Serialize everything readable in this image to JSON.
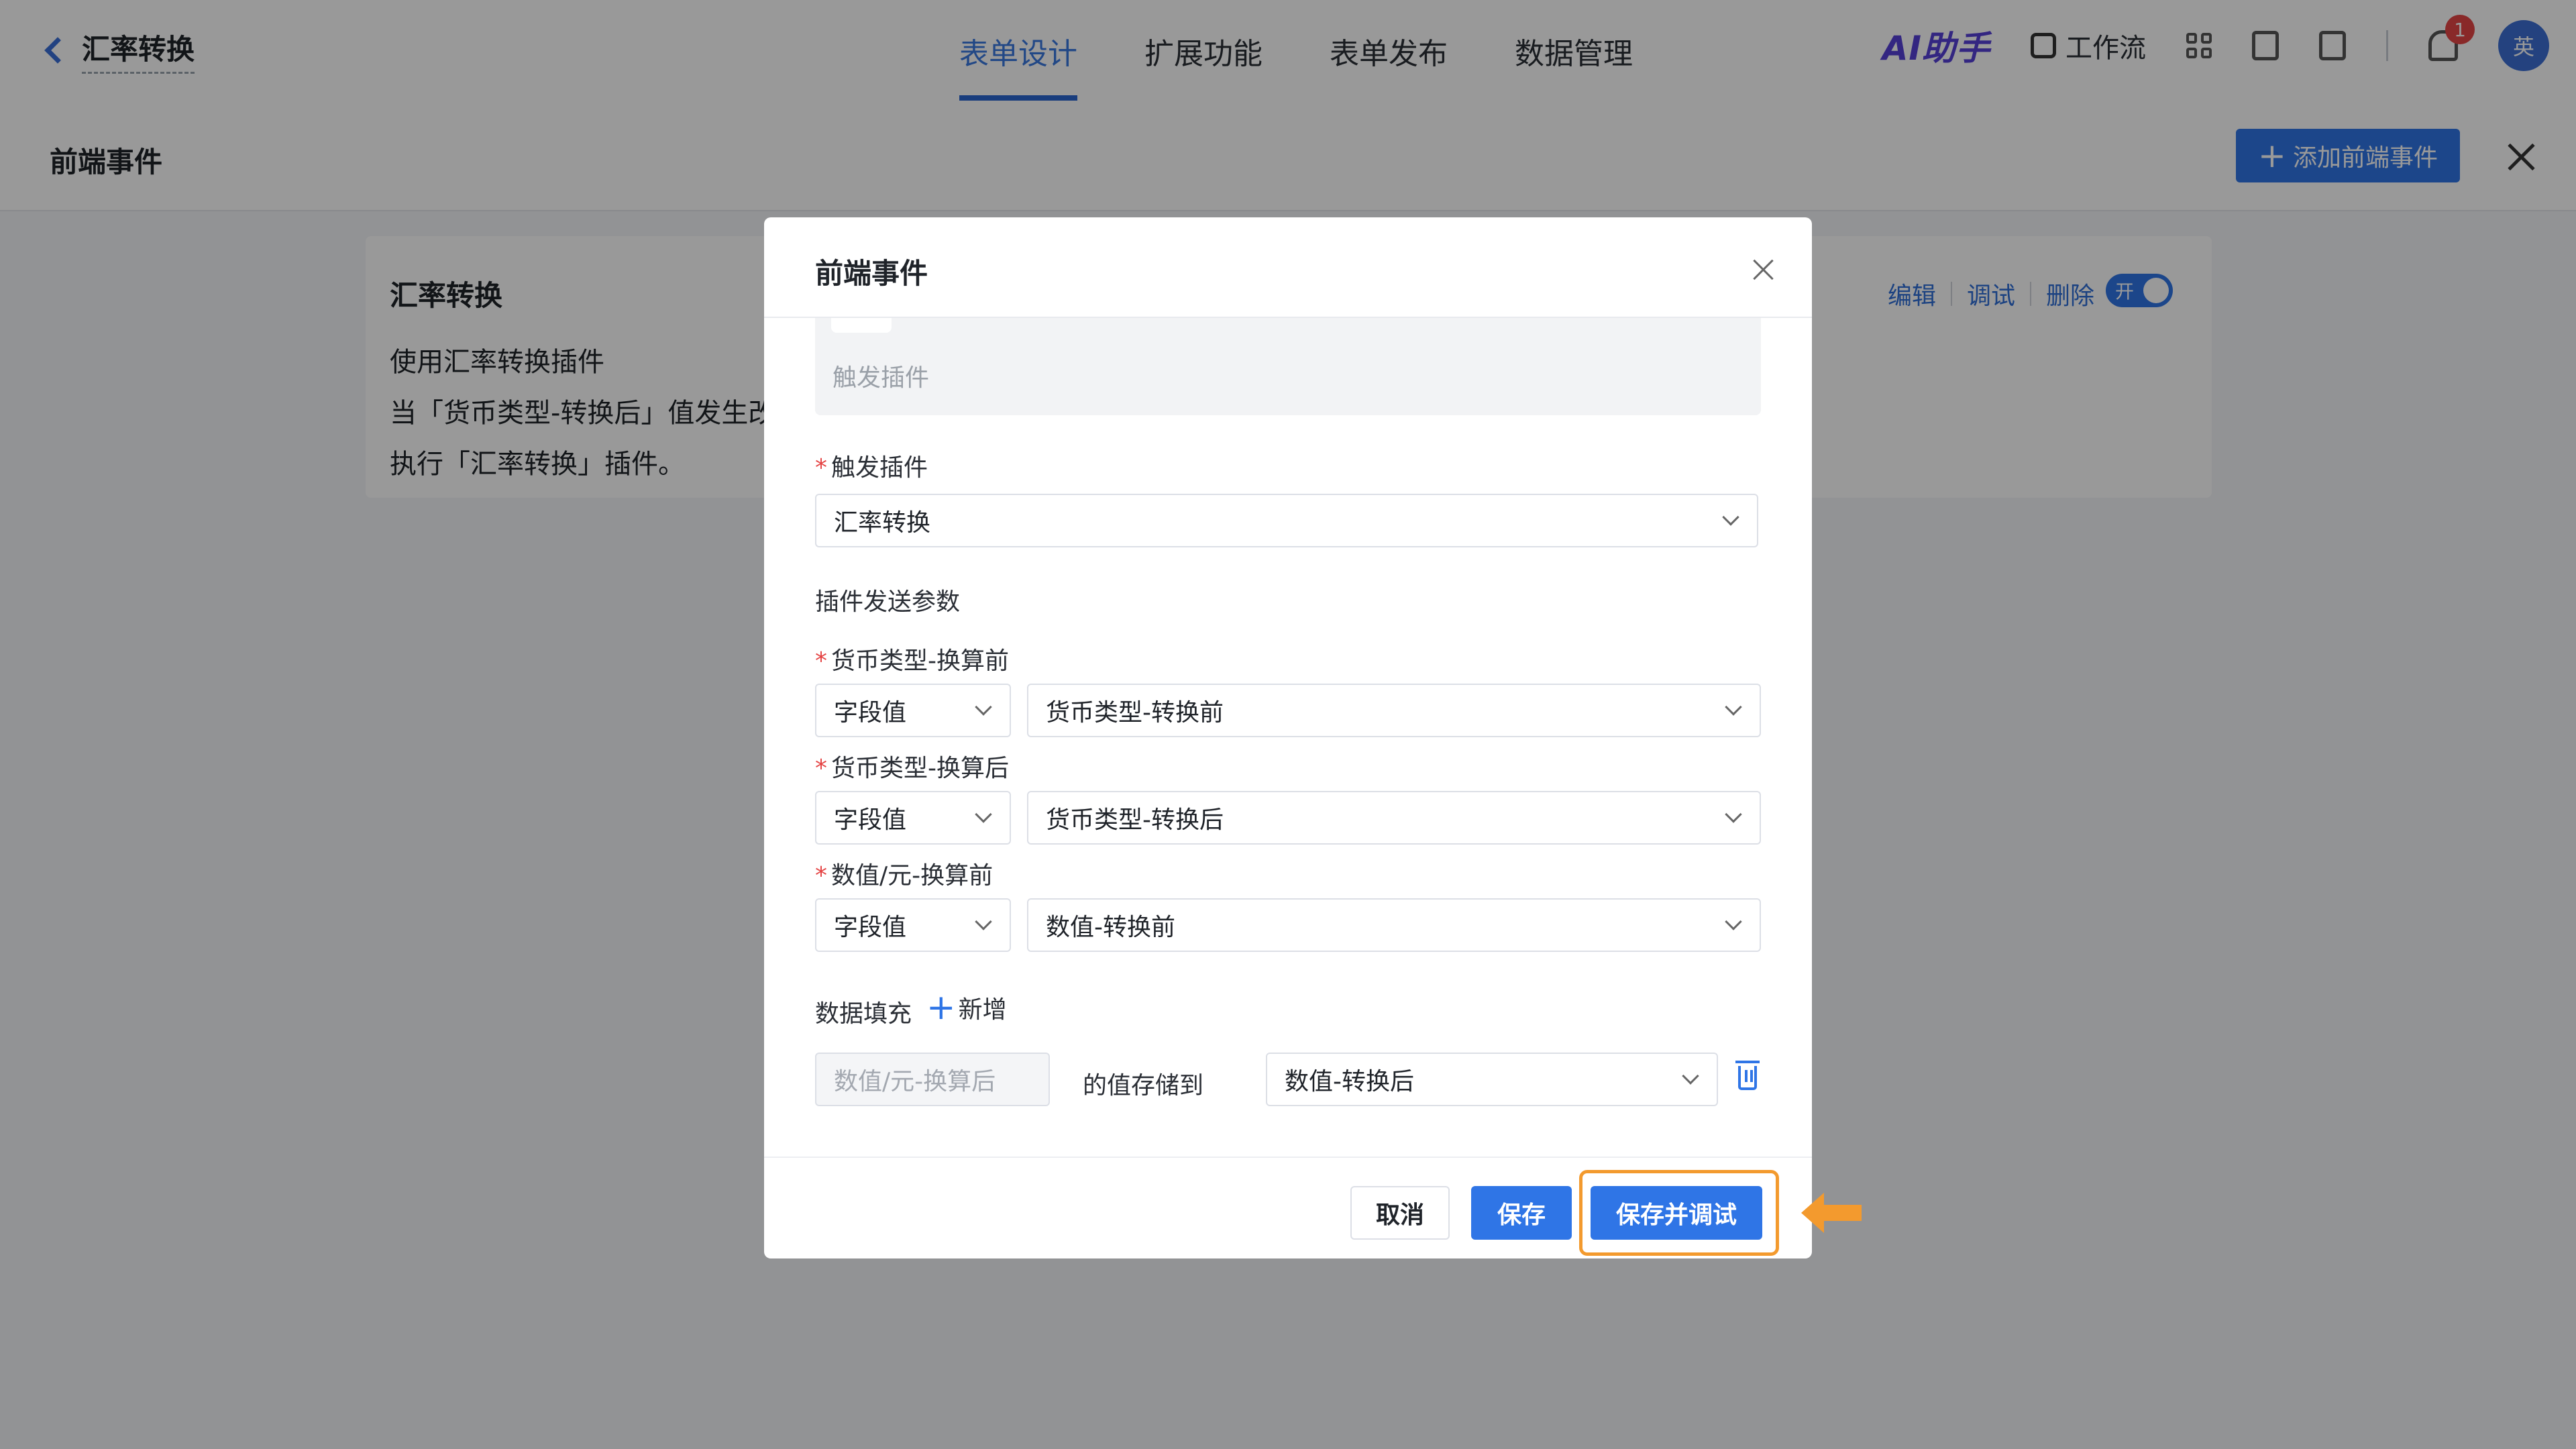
{
  "topbar": {
    "back_title": "汇率转换",
    "tabs": [
      {
        "label": "表单设计",
        "active": true
      },
      {
        "label": "扩展功能",
        "active": false
      },
      {
        "label": "表单发布",
        "active": false
      },
      {
        "label": "数据管理",
        "active": false
      }
    ],
    "ai_label": "AI助手",
    "workflow_label": "工作流",
    "notification_count": "1",
    "avatar_text": "英"
  },
  "panel": {
    "title": "前端事件",
    "add_button": "添加前端事件"
  },
  "event_card": {
    "name": "汇率转换",
    "desc_line1": "使用汇率转换插件",
    "desc_line2": "当「货币类型-转换后」值发生改",
    "desc_line3": "执行「汇率转换」插件。",
    "actions": [
      "编辑",
      "调试",
      "删除"
    ],
    "toggle_label": "开"
  },
  "modal": {
    "title": "前端事件",
    "gray_box_label": "触发插件",
    "trigger_plugin": {
      "label": "触发插件",
      "value": "汇率转换"
    },
    "params_title": "插件发送参数",
    "params": [
      {
        "label": "货币类型-换算前",
        "source": "字段值",
        "value": "货币类型-转换前"
      },
      {
        "label": "货币类型-换算后",
        "source": "字段值",
        "value": "货币类型-转换后"
      },
      {
        "label": "数值/元-换算前",
        "source": "字段值",
        "value": "数值-转换前"
      }
    ],
    "fill": {
      "title": "数据填充",
      "add_label": "新增",
      "source_placeholder": "数值/元-换算后",
      "middle_text": "的值存储到",
      "target_value": "数值-转换后"
    },
    "buttons": {
      "cancel": "取消",
      "save": "保存",
      "save_debug": "保存并调试"
    }
  },
  "colors": {
    "primary": "#2f75e6",
    "required": "#e54545",
    "highlight": "#f39a2e",
    "ai_brand": "#5540d8"
  }
}
